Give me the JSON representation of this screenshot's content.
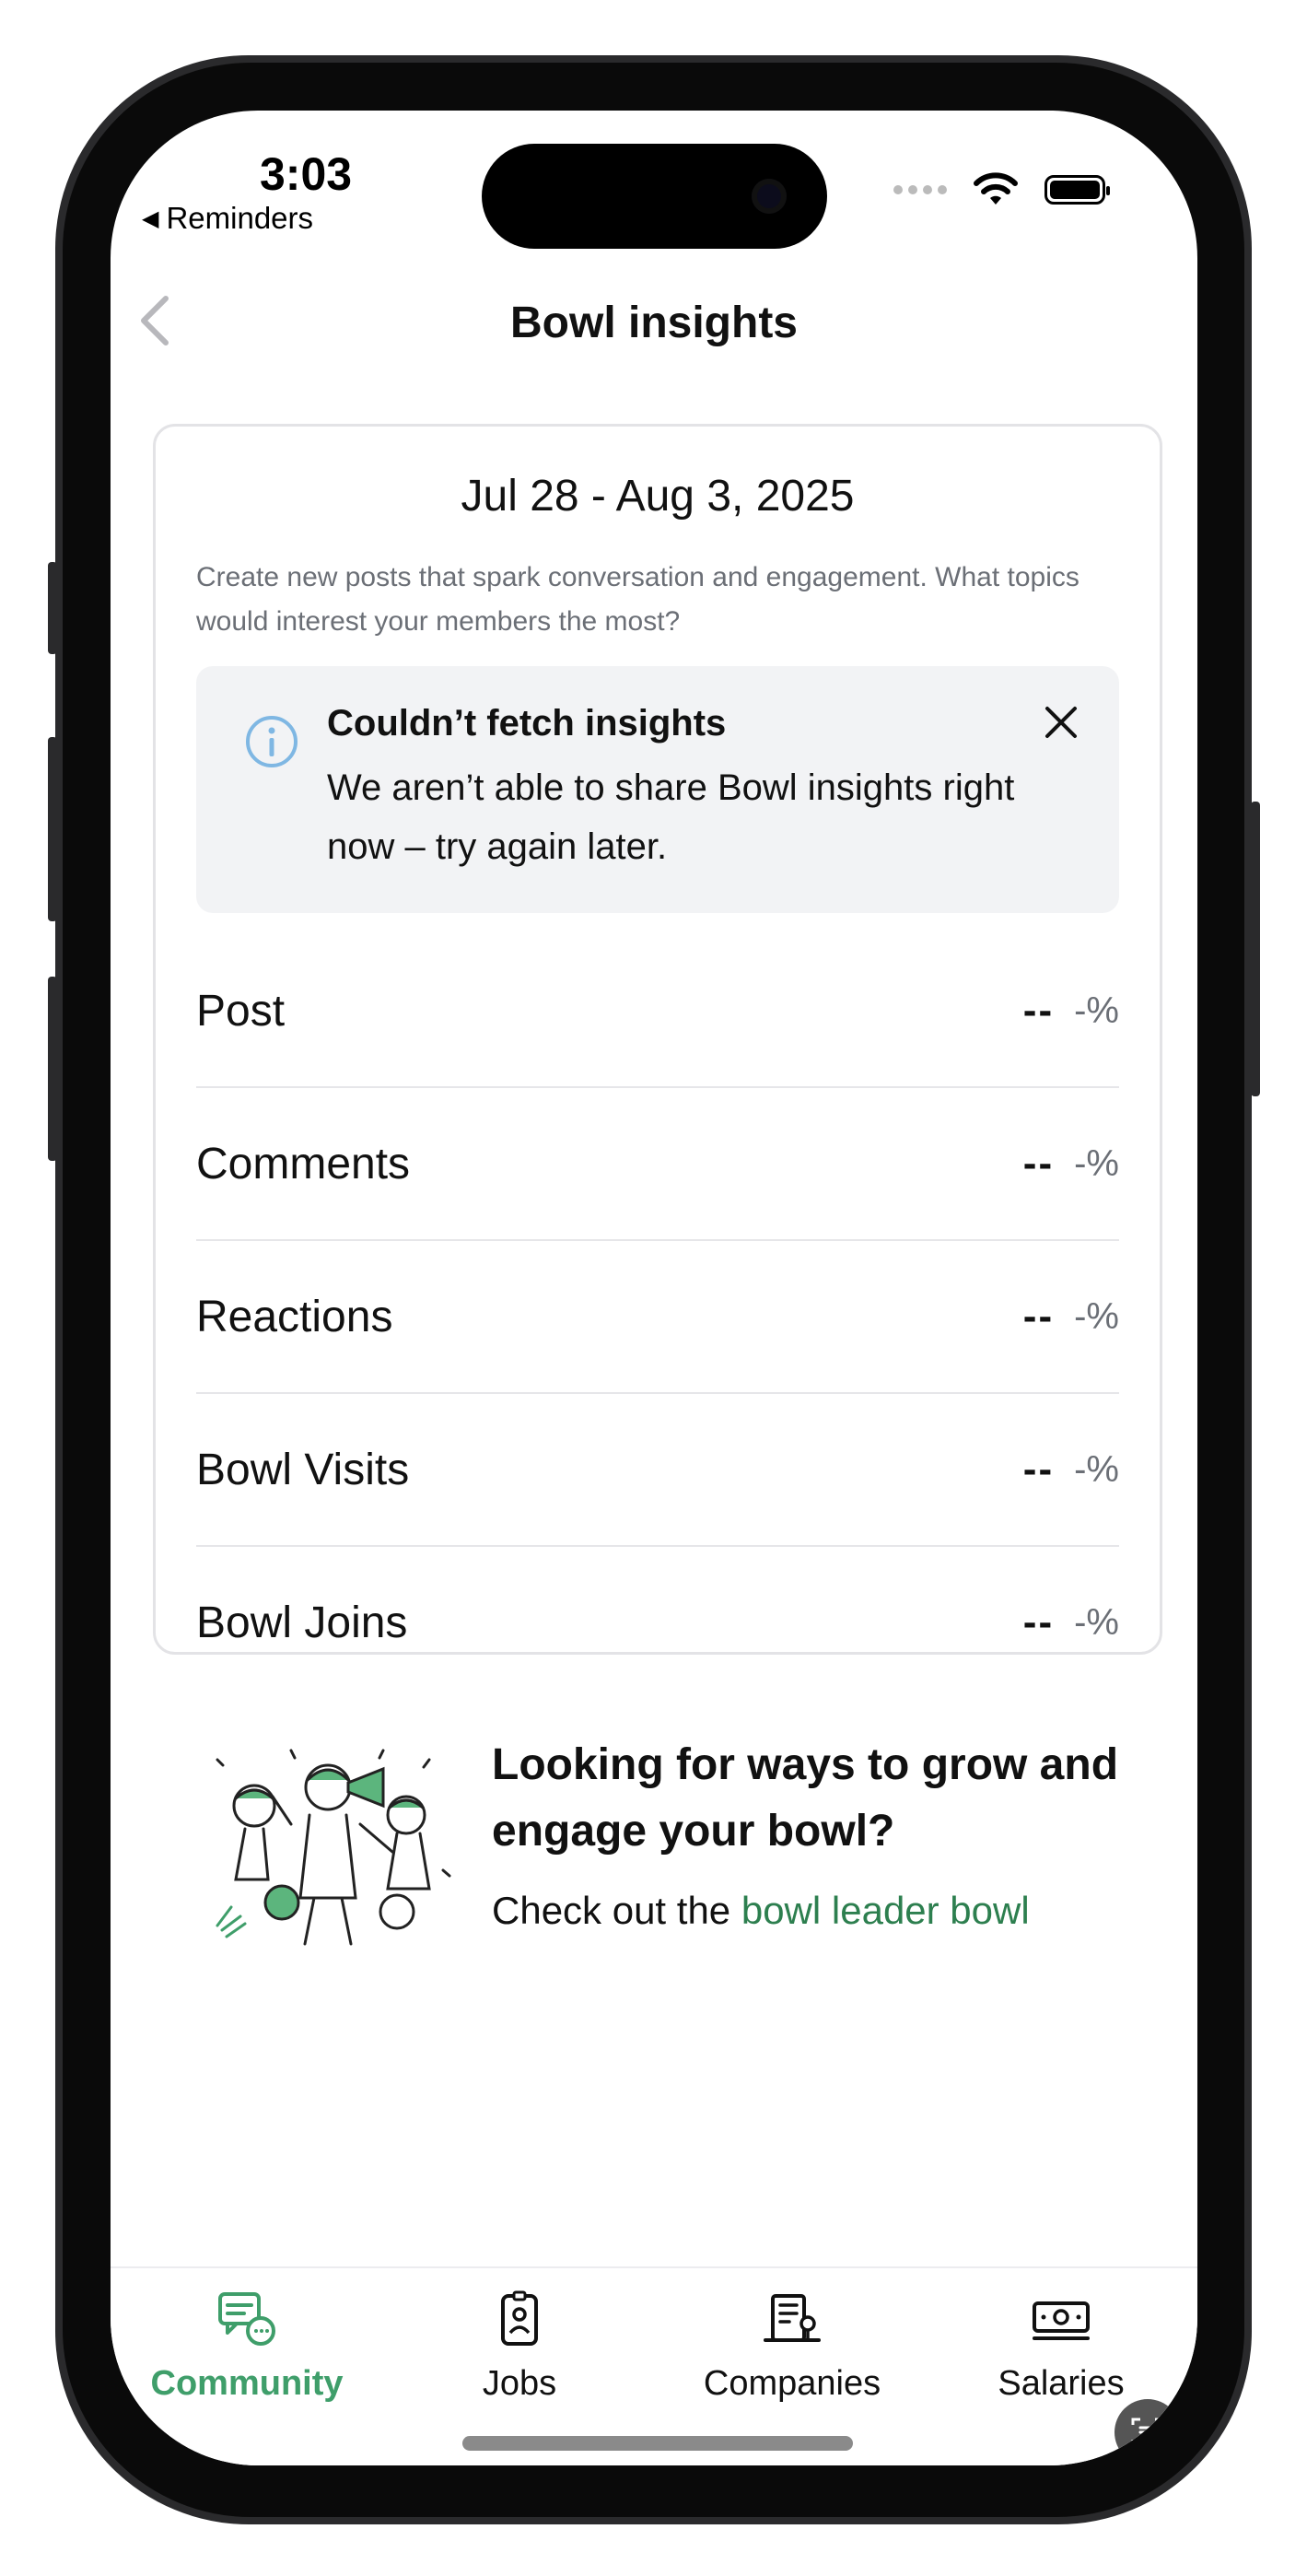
{
  "status_bar": {
    "time": "3:03",
    "back_app": "Reminders"
  },
  "header": {
    "title": "Bowl insights"
  },
  "insights": {
    "date_range": "Jul 28 - Aug 3, 2025",
    "description": "Create new posts that spark conversation and engagement. What topics would interest your members the most?",
    "alert": {
      "title": "Couldn’t fetch insights",
      "body": "We aren’t able to share Bowl insights right now – try again later."
    },
    "metrics": [
      {
        "label": "Post",
        "value": "--",
        "change": "-%"
      },
      {
        "label": "Comments",
        "value": "--",
        "change": "-%"
      },
      {
        "label": "Reactions",
        "value": "--",
        "change": "-%"
      },
      {
        "label": "Bowl Visits",
        "value": "--",
        "change": "-%"
      },
      {
        "label": "Bowl Joins",
        "value": "--",
        "change": "-%"
      }
    ]
  },
  "promo": {
    "title": "Looking for ways to grow and engage your bowl?",
    "text_prefix": "Check out the",
    "link": "bowl leader bowl"
  },
  "tabbar": {
    "tabs": [
      {
        "label": "Community",
        "icon": "community-icon",
        "active": true
      },
      {
        "label": "Jobs",
        "icon": "jobs-icon",
        "active": false
      },
      {
        "label": "Companies",
        "icon": "companies-icon",
        "active": false
      },
      {
        "label": "Salaries",
        "icon": "salaries-icon",
        "active": false
      }
    ]
  },
  "colors": {
    "accent_green": "#3f9e6a",
    "link_green": "#2d7f4f",
    "alert_bg": "#f2f3f5",
    "info_blue": "#7fb7e3"
  }
}
